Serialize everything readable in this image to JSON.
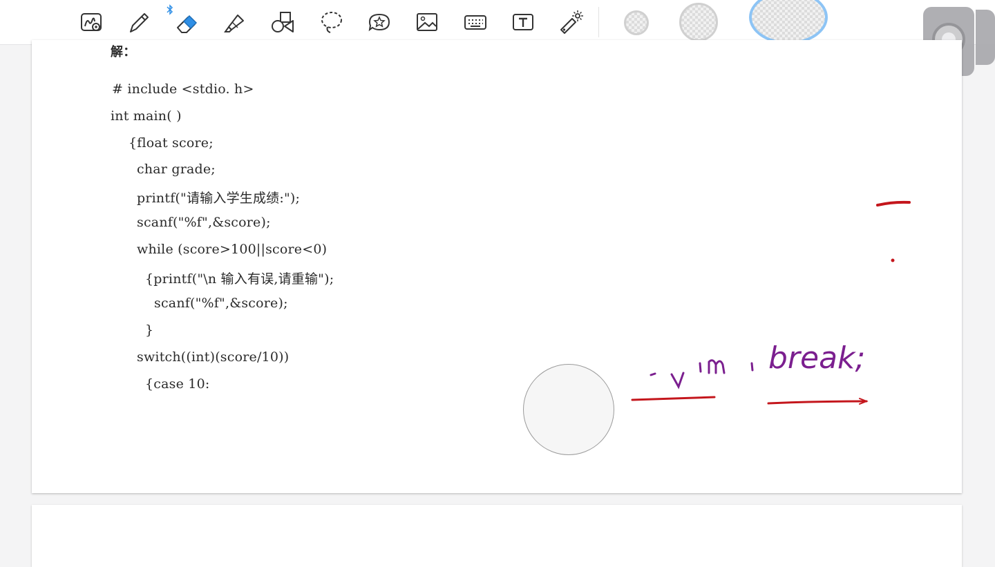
{
  "toolbar": {
    "tools": [
      {
        "id": "lasso-zoom",
        "icon": "handwriting-zoom-icon"
      },
      {
        "id": "pen",
        "icon": "pen-icon"
      },
      {
        "id": "eraser",
        "icon": "eraser-icon",
        "active": true,
        "bluetooth": true
      },
      {
        "id": "highlighter",
        "icon": "highlighter-icon"
      },
      {
        "id": "shapes",
        "icon": "shapes-icon"
      },
      {
        "id": "lasso",
        "icon": "lasso-icon"
      },
      {
        "id": "sticker",
        "icon": "sticker-icon"
      },
      {
        "id": "image",
        "icon": "image-icon"
      },
      {
        "id": "keyboard",
        "icon": "keyboard-icon"
      },
      {
        "id": "text",
        "icon": "text-box-icon"
      },
      {
        "id": "laser",
        "icon": "laser-pointer-icon"
      }
    ],
    "eraser_sizes": [
      "small",
      "medium",
      "large"
    ],
    "accent_color": "#2f8fe6",
    "selected_size_color": "#8dc4f5"
  },
  "document": {
    "heading": "解：",
    "code_lines": [
      "# include <stdio. h>",
      "int main( )",
      "{float score;",
      "char grade;",
      "printf(\"请输入学生成绩:\");",
      "scanf(\"%f\",&score);",
      "while (score>100||score<0)",
      "{printf(\"\\n 输入有误,请重输\");",
      "scanf(\"%f\",&score);",
      "}",
      "switch((int)(score/10))",
      "{case 10:"
    ]
  },
  "annotations": {
    "handwriting_text": "break;",
    "handwriting_color": "#7b1f8f",
    "underline_color": "#c4161c"
  }
}
